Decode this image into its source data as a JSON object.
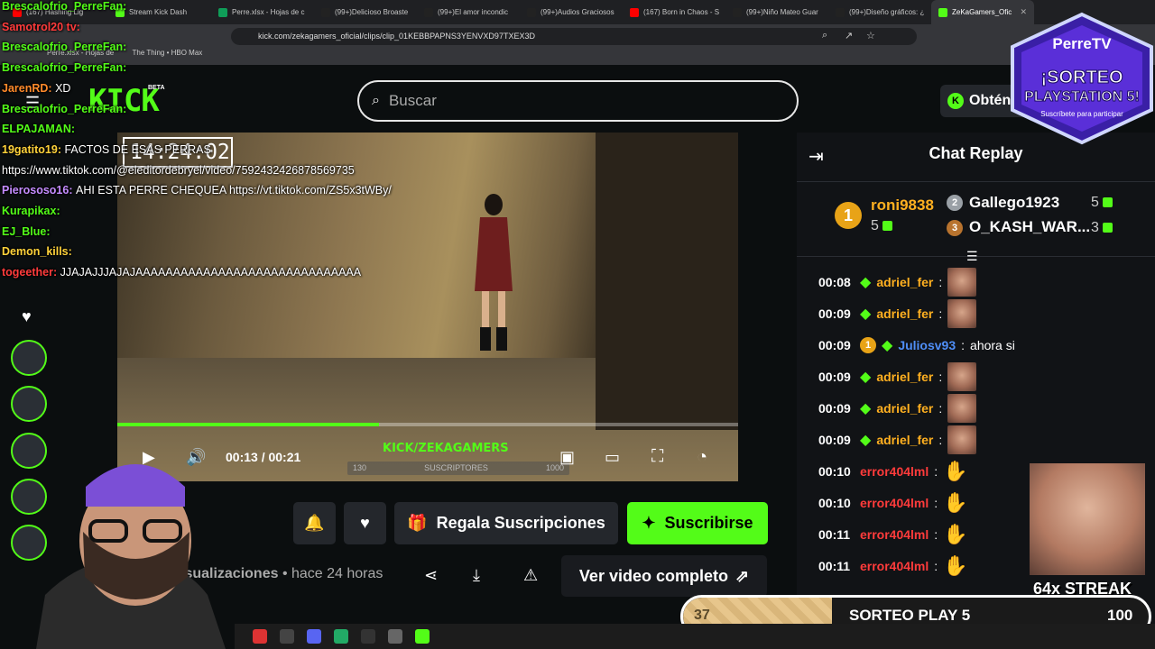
{
  "browser": {
    "tabs": [
      {
        "label": "(167) Hashing Lig",
        "color": "#ff0000"
      },
      {
        "label": "Stream Kick Dash",
        "color": "#53fc18"
      },
      {
        "label": "Perre.xlsx - Hojas de c",
        "color": "#0f9d58"
      },
      {
        "label": "(99+)Delicioso Broaste",
        "color": "#222"
      },
      {
        "label": "(99+)El amor incondic",
        "color": "#222"
      },
      {
        "label": "(99+)Audios Graciosos",
        "color": "#222"
      },
      {
        "label": "(167) Born in Chaos - S",
        "color": "#ff0000"
      },
      {
        "label": "(99+)Niño Mateo Guar",
        "color": "#222"
      },
      {
        "label": "(99+)Diseño gráficos: ¿",
        "color": "#222"
      },
      {
        "label": "ZeKaGamers_Ofic",
        "color": "#53fc18",
        "active": true
      }
    ],
    "url": "kick.com/zekagamers_oficial/clips/clip_01KEBBPAPNS3YENVXD97TXEX3D",
    "bookmarks": [
      "Perre.xlsx - Hojas de",
      "The Thing • HBO Max"
    ]
  },
  "site": {
    "logo": "KICK",
    "beta": "BETA",
    "search_placeholder": "Buscar",
    "obtain_label": "Obtén"
  },
  "video": {
    "overlay_clock": "14:24:02",
    "time": "00:13 / 00:21",
    "watermark": "KICK/ZEKAGAMERS",
    "sub_label": "SUSCRIPTORES",
    "sub_min": "130",
    "sub_max": "1000",
    "progress": 0.62
  },
  "actions": {
    "gift_label": "Regala Suscripciones",
    "subscribe_label": "Suscribirse",
    "views_text": "isualizaciones",
    "age_text": "hace 24 horas",
    "full_video_label": "Ver video completo"
  },
  "chat": {
    "title": "Chat Replay",
    "leaders": [
      {
        "rank": "1",
        "name": "roni9838",
        "count": "5",
        "color": "#e8a317"
      },
      {
        "rank": "2",
        "name": "Gallego1923",
        "count": "5",
        "color": "#9aa0a6"
      },
      {
        "rank": "3",
        "name": "O_KASH_WAR...",
        "count": "3",
        "color": "#b8732e"
      }
    ],
    "messages": [
      {
        "ts": "00:08",
        "user": "adriel_fer",
        "color": "#ffb020",
        "type": "emote"
      },
      {
        "ts": "00:09",
        "user": "adriel_fer",
        "color": "#ffb020",
        "type": "emote"
      },
      {
        "ts": "00:09",
        "user": "Juliosv93",
        "color": "#4f8ef7",
        "type": "text",
        "text": "ahora si",
        "badge": "1"
      },
      {
        "ts": "00:09",
        "user": "adriel_fer",
        "color": "#ffb020",
        "type": "emote"
      },
      {
        "ts": "00:09",
        "user": "adriel_fer",
        "color": "#ffb020",
        "type": "emote"
      },
      {
        "ts": "00:09",
        "user": "adriel_fer",
        "color": "#ffb020",
        "type": "emote"
      },
      {
        "ts": "00:10",
        "user": "error404lml",
        "color": "#ff3b3b",
        "type": "wave"
      },
      {
        "ts": "00:10",
        "user": "error404lml",
        "color": "#ff3b3b",
        "type": "wave"
      },
      {
        "ts": "00:11",
        "user": "error404lml",
        "color": "#ff3b3b",
        "type": "wave"
      },
      {
        "ts": "00:11",
        "user": "error404lml",
        "color": "#ff3b3b",
        "type": "wave"
      }
    ]
  },
  "overlay_chat": [
    {
      "user": "Brescalofrio_PerreFan:",
      "color": "#53fc18",
      "text": ""
    },
    {
      "user": "Samotrol20 tv:",
      "color": "#ff3b3b",
      "text": ""
    },
    {
      "user": "Brescalofrio_PerreFan:",
      "color": "#53fc18",
      "text": ""
    },
    {
      "user": "Brescalofrio_PerreFan:",
      "color": "#53fc18",
      "text": ""
    },
    {
      "user": "JarenRD:",
      "color": "#ff8a2a",
      "text": "XD"
    },
    {
      "user": "Brescalofrio_PerreFan:",
      "color": "#53fc18",
      "text": ""
    },
    {
      "user": "ELPAJAMAN:",
      "color": "#53fc18",
      "text": ""
    },
    {
      "user": "19gatito19:",
      "color": "#ffd23a",
      "text": "FACTOS DE ESAS PERRAS"
    },
    {
      "user": "",
      "color": "#fff",
      "text": "https://www.tiktok.com/@eleditordebryel/video/7592432426878569735"
    },
    {
      "user": "Pierososo16:",
      "color": "#c58cff",
      "text": "AHI ESTA PERRE CHEQUEA https://vt.tiktok.com/ZS5x3tWBy/"
    },
    {
      "user": "Kurapikax:",
      "color": "#53fc18",
      "text": ""
    },
    {
      "user": "EJ_Blue:",
      "color": "#53fc18",
      "text": ""
    },
    {
      "user": "Demon_kills:",
      "color": "#ffd23a",
      "text": ""
    },
    {
      "user": "togeether:",
      "color": "#ff3b3b",
      "text": "JJAJAJJJAJAJAAAAAAAAAAAAAAAAAAAAAAAAAAAAAA"
    }
  ],
  "badge": {
    "brand": "PerreTV",
    "line1": "¡SORTEO",
    "line2": "PLAYSTATION 5!",
    "line3": "Suscríbete para participar"
  },
  "streak": "64x STREAK",
  "sorteo": {
    "current": "37",
    "label": "SORTEO PLAY 5",
    "goal": "100",
    "progress": 0.37
  }
}
